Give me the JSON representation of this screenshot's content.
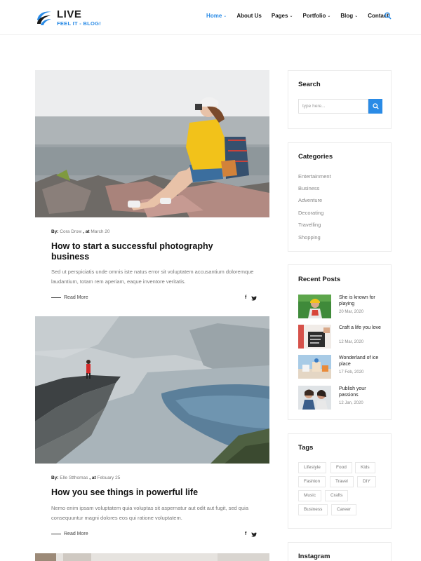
{
  "brand": {
    "title": "LIVE",
    "tagline": "FEEL IT - BLOG!"
  },
  "nav": {
    "items": [
      {
        "label": "Home",
        "dropdown": true,
        "active": true
      },
      {
        "label": "About Us",
        "dropdown": false,
        "active": false
      },
      {
        "label": "Pages",
        "dropdown": true,
        "active": false
      },
      {
        "label": "Portfolio",
        "dropdown": true,
        "active": false
      },
      {
        "label": "Blog",
        "dropdown": true,
        "active": false
      },
      {
        "label": "Contact",
        "dropdown": false,
        "active": false
      }
    ],
    "search_icon": "search-icon"
  },
  "posts": [
    {
      "by_label": "By:",
      "author": "Cora Drow",
      "at_label": ", at",
      "date": "March 20",
      "title": "How to start a successful photography business",
      "excerpt": "Sed ut perspiciatis unde omnis iste natus error sit voluptatem accusantium doloremque laudantium, totam rem aperiam, eaque inventore veritatis.",
      "read_more": "Read More"
    },
    {
      "by_label": "By:",
      "author": "Elle Stthomas",
      "at_label": ", at",
      "date": "Febuary 25",
      "title": "How you see things in powerful life",
      "excerpt": "Nemo enim ipsam voluptatem quia voluptas sit aspernatur aut odit aut fugit, sed quia consequuntur magni dolores eos qui ratione voluptatem.",
      "read_more": "Read More"
    }
  ],
  "sidebar": {
    "search": {
      "title": "Search",
      "placeholder": "type here..."
    },
    "categories": {
      "title": "Categories",
      "items": [
        "Entertainment",
        "Business",
        "Adventure",
        "Decorating",
        "Travelling",
        "Shopping"
      ]
    },
    "recent_posts": {
      "title": "Recent Posts",
      "items": [
        {
          "title": "She is known for playing",
          "date": "20 Mar, 2020"
        },
        {
          "title": "Craft a life you love",
          "date": "12 Mar, 2020"
        },
        {
          "title": "Wonderland of ice place",
          "date": "17 Feb, 2020"
        },
        {
          "title": "Publish your passions",
          "date": "12 Jan, 2020"
        }
      ]
    },
    "tags": {
      "title": "Tags",
      "items": [
        "Lifestyle",
        "Food",
        "Kids",
        "Fashion",
        "Travel",
        "DIY",
        "Music",
        "Crafts",
        "Business",
        "Career"
      ]
    },
    "instagram": {
      "title": "Instagram"
    }
  },
  "colors": {
    "accent": "#2a8be6",
    "text": "#1a1a1a",
    "muted": "#888888"
  }
}
